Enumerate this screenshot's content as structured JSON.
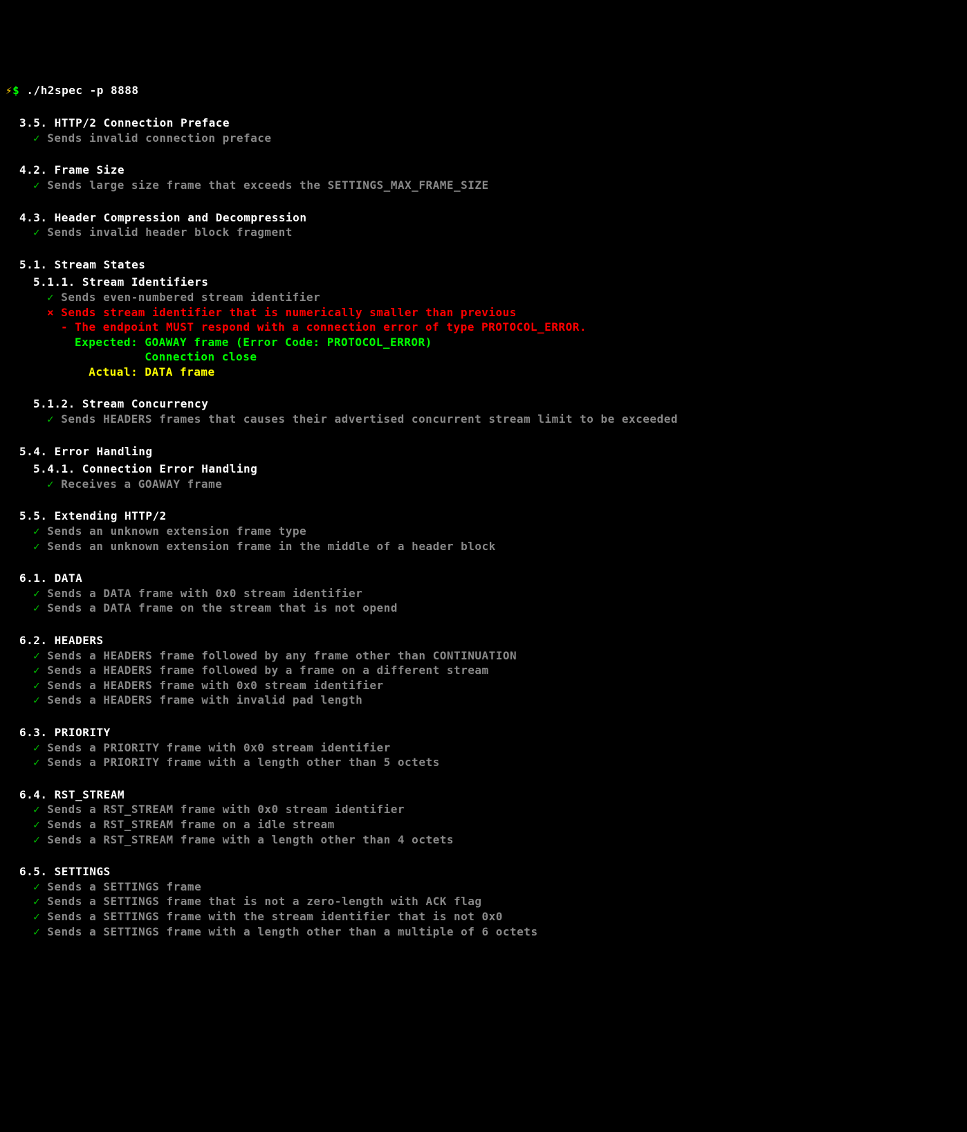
{
  "prompt": {
    "lightning": "⚡",
    "dollar": "$",
    "command": "./h2spec -p 8888"
  },
  "sections": [
    {
      "title": "3.5. HTTP/2 Connection Preface",
      "indent": 1,
      "items": [
        {
          "type": "pass",
          "text": "Sends invalid connection preface",
          "indent": 2
        }
      ]
    },
    {
      "title": "4.2. Frame Size",
      "indent": 1,
      "items": [
        {
          "type": "pass",
          "text": "Sends large size frame that exceeds the SETTINGS_MAX_FRAME_SIZE",
          "indent": 2
        }
      ]
    },
    {
      "title": "4.3. Header Compression and Decompression",
      "indent": 1,
      "items": [
        {
          "type": "pass",
          "text": "Sends invalid header block fragment",
          "indent": 2
        }
      ]
    },
    {
      "title": "5.1. Stream States",
      "indent": 1,
      "items": []
    },
    {
      "title": "5.1.1. Stream Identifiers",
      "indent": 2,
      "nospacer": true,
      "items": [
        {
          "type": "pass",
          "text": "Sends even-numbered stream identifier",
          "indent": 3
        },
        {
          "type": "fail",
          "text": "Sends stream identifier that is numerically smaller than previous",
          "indent": 3,
          "detail": "- The endpoint MUST respond with a connection error of type PROTOCOL_ERROR.",
          "expected_label": "Expected:",
          "expected": [
            "GOAWAY frame (Error Code: PROTOCOL_ERROR)",
            "Connection close"
          ],
          "actual_label": "Actual:",
          "actual": "DATA frame"
        }
      ]
    },
    {
      "title": "5.1.2. Stream Concurrency",
      "indent": 2,
      "items": [
        {
          "type": "pass",
          "text": "Sends HEADERS frames that causes their advertised concurrent stream limit to be exceeded",
          "indent": 3
        }
      ]
    },
    {
      "title": "5.4. Error Handling",
      "indent": 1,
      "items": []
    },
    {
      "title": "5.4.1. Connection Error Handling",
      "indent": 2,
      "nospacer": true,
      "items": [
        {
          "type": "pass",
          "text": "Receives a GOAWAY frame",
          "indent": 3
        }
      ]
    },
    {
      "title": "5.5. Extending HTTP/2",
      "indent": 1,
      "items": [
        {
          "type": "pass",
          "text": "Sends an unknown extension frame type",
          "indent": 2
        },
        {
          "type": "pass",
          "text": "Sends an unknown extension frame in the middle of a header block",
          "indent": 2
        }
      ]
    },
    {
      "title": "6.1. DATA",
      "indent": 1,
      "items": [
        {
          "type": "pass",
          "text": "Sends a DATA frame with 0x0 stream identifier",
          "indent": 2
        },
        {
          "type": "pass",
          "text": "Sends a DATA frame on the stream that is not opend",
          "indent": 2
        }
      ]
    },
    {
      "title": "6.2. HEADERS",
      "indent": 1,
      "items": [
        {
          "type": "pass",
          "text": "Sends a HEADERS frame followed by any frame other than CONTINUATION",
          "indent": 2
        },
        {
          "type": "pass",
          "text": "Sends a HEADERS frame followed by a frame on a different stream",
          "indent": 2
        },
        {
          "type": "pass",
          "text": "Sends a HEADERS frame with 0x0 stream identifier",
          "indent": 2
        },
        {
          "type": "pass",
          "text": "Sends a HEADERS frame with invalid pad length",
          "indent": 2
        }
      ]
    },
    {
      "title": "6.3. PRIORITY",
      "indent": 1,
      "items": [
        {
          "type": "pass",
          "text": "Sends a PRIORITY frame with 0x0 stream identifier",
          "indent": 2
        },
        {
          "type": "pass",
          "text": "Sends a PRIORITY frame with a length other than 5 octets",
          "indent": 2
        }
      ]
    },
    {
      "title": "6.4. RST_STREAM",
      "indent": 1,
      "items": [
        {
          "type": "pass",
          "text": "Sends a RST_STREAM frame with 0x0 stream identifier",
          "indent": 2
        },
        {
          "type": "pass",
          "text": "Sends a RST_STREAM frame on a idle stream",
          "indent": 2
        },
        {
          "type": "pass",
          "text": "Sends a RST_STREAM frame with a length other than 4 octets",
          "indent": 2
        }
      ]
    },
    {
      "title": "6.5. SETTINGS",
      "indent": 1,
      "items": [
        {
          "type": "pass",
          "text": "Sends a SETTINGS frame",
          "indent": 2
        },
        {
          "type": "pass",
          "text": "Sends a SETTINGS frame that is not a zero-length with ACK flag",
          "indent": 2
        },
        {
          "type": "pass",
          "text": "Sends a SETTINGS frame with the stream identifier that is not 0x0",
          "indent": 2
        },
        {
          "type": "pass",
          "text": "Sends a SETTINGS frame with a length other than a multiple of 6 octets",
          "indent": 2
        }
      ]
    }
  ]
}
